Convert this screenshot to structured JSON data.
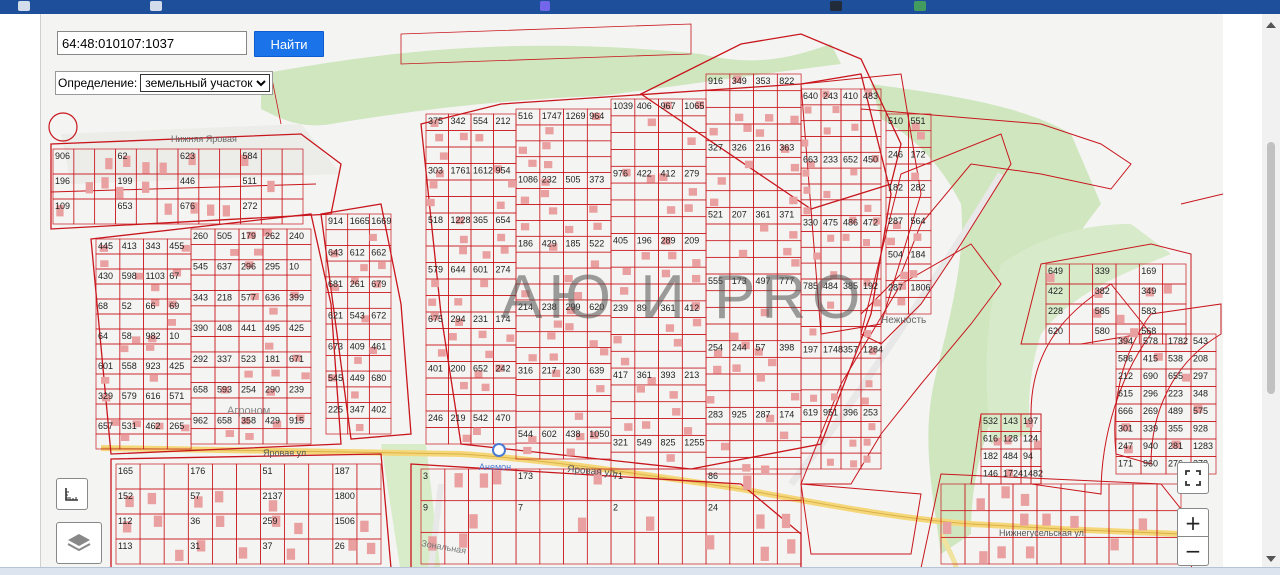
{
  "search": {
    "value": "64:48:010107:1037",
    "button_label": "Найти"
  },
  "definition": {
    "label": "Определение:",
    "selected": "земельный участок"
  },
  "watermark": "АЮ И PRO",
  "streets": [
    {
      "id": "yarovaya-1",
      "name": "Яровая ул."
    },
    {
      "id": "yarovaya-2",
      "name": "Яровая ул."
    },
    {
      "id": "nizhneguselskaya",
      "name": "Нижнегусельская ул."
    },
    {
      "id": "nizhnaya-yarovaya",
      "name": "Нижняя Яровая"
    },
    {
      "id": "zonalnaya",
      "name": "Зональная"
    },
    {
      "id": "nezhnost",
      "name": "Нежность"
    }
  ],
  "places": [
    {
      "id": "agronom",
      "name": "Агроном"
    },
    {
      "id": "anemon",
      "name": "Анемон"
    }
  ],
  "parcel_labels": [
    "906",
    "62",
    "623",
    "584",
    "196",
    "199",
    "446",
    "511",
    "109",
    "653",
    "676",
    "272",
    "445",
    "413",
    "343",
    "455",
    "430",
    "598",
    "1103",
    "67",
    "68",
    "52",
    "66",
    "69",
    "64",
    "58",
    "982",
    "10",
    "601",
    "558",
    "923",
    "425",
    "329",
    "579",
    "616",
    "571",
    "657",
    "531",
    "462",
    "265",
    "260",
    "505",
    "179",
    "262",
    "240",
    "545",
    "637",
    "296",
    "295",
    "10",
    "343",
    "218",
    "577",
    "636",
    "399",
    "390",
    "408",
    "441",
    "495",
    "425",
    "292",
    "337",
    "523",
    "181",
    "671",
    "658",
    "593",
    "254",
    "290",
    "239",
    "962",
    "658",
    "358",
    "429",
    "915",
    "914",
    "1665",
    "1669",
    "643",
    "612",
    "662",
    "681",
    "261",
    "679",
    "621",
    "543",
    "672",
    "673",
    "409",
    "461",
    "545",
    "449",
    "680",
    "225",
    "347",
    "402",
    "375",
    "342",
    "554",
    "212",
    "303",
    "1761",
    "1612",
    "954",
    "518",
    "1228",
    "365",
    "654",
    "579",
    "644",
    "601",
    "274",
    "675",
    "294",
    "231",
    "174",
    "401",
    "200",
    "652",
    "242",
    "246",
    "219",
    "542",
    "470",
    "516",
    "1747",
    "1269",
    "964",
    "1086",
    "232",
    "505",
    "373",
    "186",
    "429",
    "185",
    "522",
    "214",
    "238",
    "299",
    "620",
    "316",
    "217",
    "230",
    "639",
    "544",
    "602",
    "438",
    "1050",
    "1039",
    "406",
    "967",
    "1065",
    "976",
    "422",
    "412",
    "279",
    "405",
    "196",
    "289",
    "209",
    "239",
    "89",
    "361",
    "412",
    "417",
    "361",
    "393",
    "213",
    "321",
    "549",
    "825",
    "1255",
    "916",
    "349",
    "353",
    "822",
    "327",
    "326",
    "216",
    "363",
    "521",
    "207",
    "361",
    "371",
    "555",
    "173",
    "497",
    "777",
    "254",
    "244",
    "57",
    "398",
    "283",
    "925",
    "287",
    "174",
    "640",
    "243",
    "410",
    "483",
    "663",
    "233",
    "652",
    "450",
    "330",
    "475",
    "486",
    "472",
    "785",
    "484",
    "385",
    "192",
    "197",
    "1748",
    "357",
    "1284",
    "619",
    "951",
    "396",
    "253",
    "510",
    "551",
    "246",
    "172",
    "182",
    "282",
    "287",
    "564",
    "504",
    "184",
    "287",
    "1806",
    "649",
    "339",
    "169",
    "422",
    "382",
    "349",
    "228",
    "585",
    "583",
    "620",
    "580",
    "568",
    "394",
    "578",
    "1782",
    "543",
    "586",
    "415",
    "538",
    "208",
    "212",
    "690",
    "655",
    "297",
    "615",
    "296",
    "223",
    "348",
    "666",
    "269",
    "489",
    "575",
    "301",
    "339",
    "355",
    "928",
    "247",
    "940",
    "281",
    "1283",
    "171",
    "960",
    "276",
    "273",
    "532",
    "143",
    "197",
    "616",
    "128",
    "124",
    "182",
    "484",
    "94",
    "146",
    "1724",
    "1482",
    "165",
    "176",
    "51",
    "187",
    "152",
    "57",
    "2137",
    "1800",
    "112",
    "36",
    "259",
    "1506",
    "113",
    "31",
    "37",
    "26",
    "3",
    "173",
    "71",
    "86",
    "9",
    "7",
    "2",
    "24"
  ]
}
